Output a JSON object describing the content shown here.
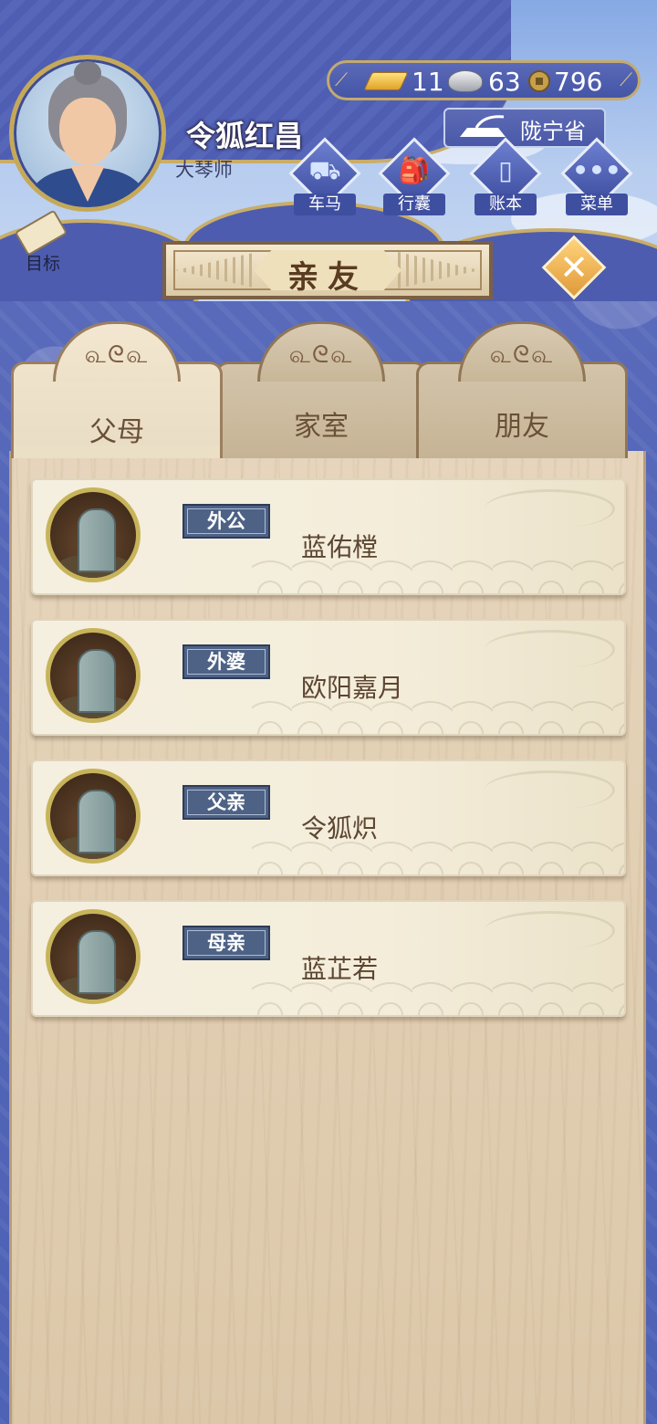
{
  "player": {
    "name": "令狐红昌",
    "title": "大琴师"
  },
  "currency": {
    "gold": "11",
    "silver": "63",
    "coins": "796"
  },
  "location": {
    "name": "陇宁省"
  },
  "menu": [
    {
      "label": "车马",
      "icon": "carriage-icon"
    },
    {
      "label": "行囊",
      "icon": "bag-icon"
    },
    {
      "label": "账本",
      "icon": "ledger-icon"
    },
    {
      "label": "菜单",
      "icon": "more-icon"
    }
  ],
  "target": {
    "label": "目标"
  },
  "page": {
    "title": "亲友"
  },
  "tabs": [
    {
      "label": "父母",
      "active": true
    },
    {
      "label": "家室",
      "active": false
    },
    {
      "label": "朋友",
      "active": false
    }
  ],
  "relatives": [
    {
      "relation": "外公",
      "name": "蓝佑樘"
    },
    {
      "relation": "外婆",
      "name": "欧阳嘉月"
    },
    {
      "relation": "父亲",
      "name": "令狐炽"
    },
    {
      "relation": "母亲",
      "name": "蓝芷若"
    }
  ],
  "colors": {
    "accent_gold": "#c9ad69",
    "relation_badge": "#4d6285",
    "name_text": "#5c4632"
  }
}
